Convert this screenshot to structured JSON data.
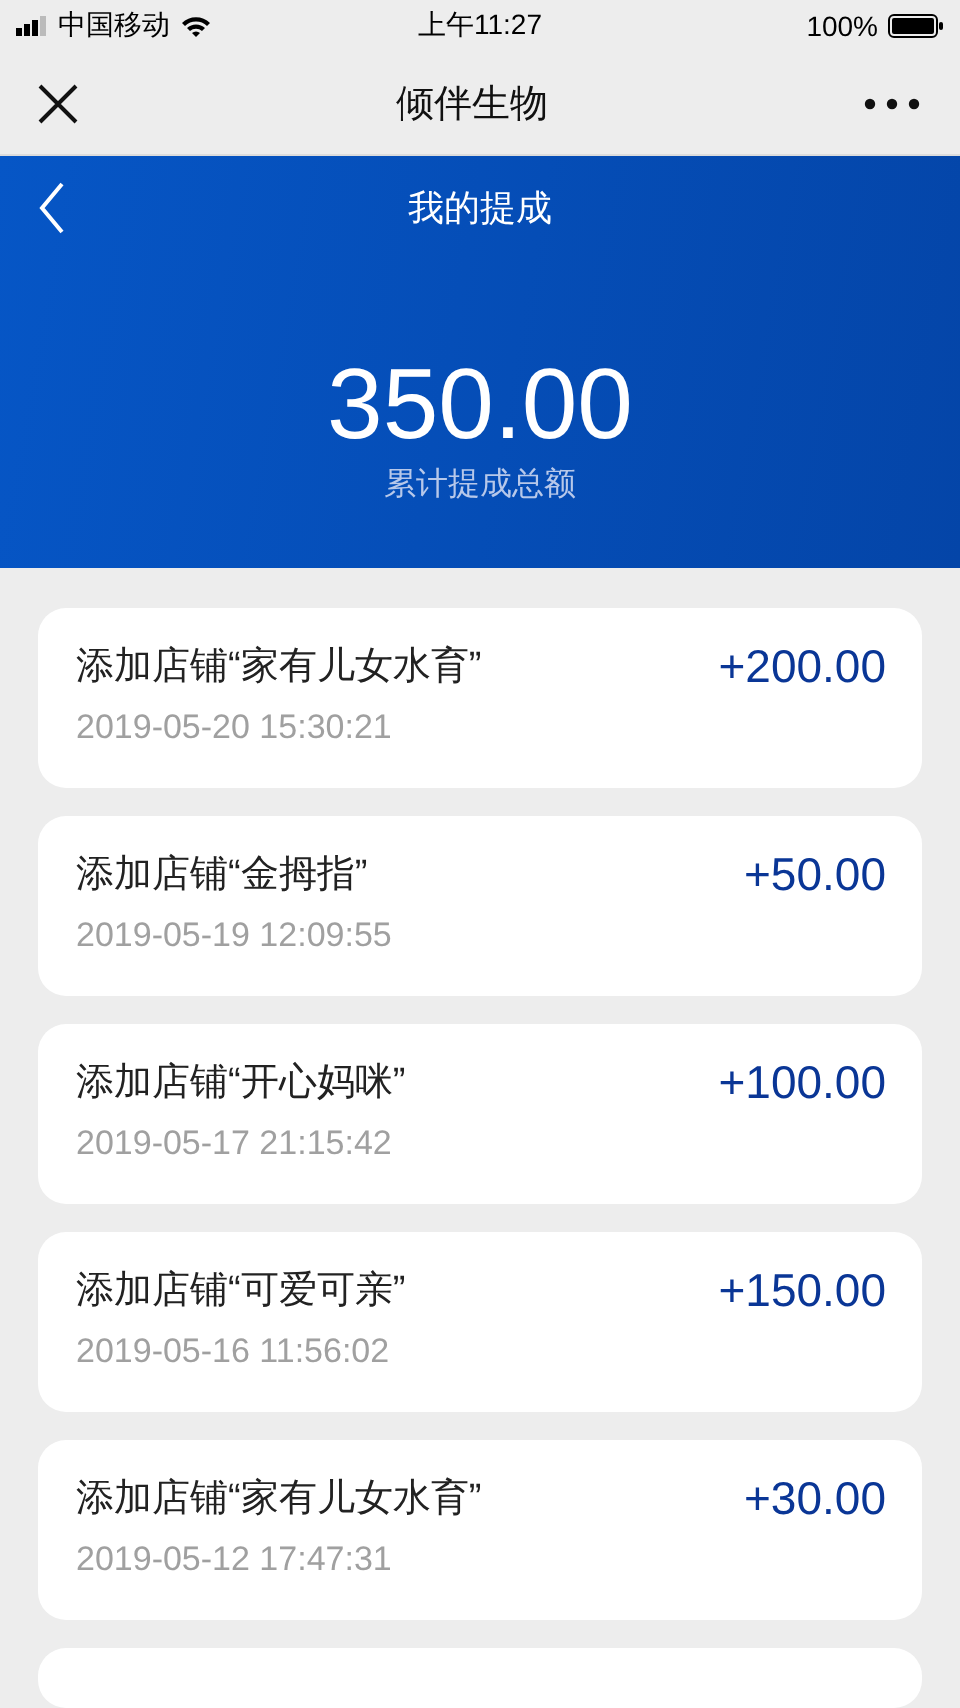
{
  "status_bar": {
    "carrier": "中国移动",
    "time": "上午11:27",
    "battery": "100%"
  },
  "nav_bar": {
    "title": "倾伴生物"
  },
  "header": {
    "title": "我的提成",
    "total": "350.00",
    "total_label": "累计提成总额"
  },
  "records": [
    {
      "title": "添加店铺“家有儿女水育”",
      "time": "2019-05-20 15:30:21",
      "amount": "+200.00"
    },
    {
      "title": "添加店铺“金拇指”",
      "time": "2019-05-19 12:09:55",
      "amount": "+50.00"
    },
    {
      "title": "添加店铺“开心妈咪”",
      "time": "2019-05-17 21:15:42",
      "amount": "+100.00"
    },
    {
      "title": "添加店铺“可爱可亲”",
      "time": "2019-05-16 11:56:02",
      "amount": "+150.00"
    },
    {
      "title": "添加店铺“家有儿女水育”",
      "time": "2019-05-12 17:47:31",
      "amount": "+30.00"
    }
  ],
  "more_records_below": true
}
